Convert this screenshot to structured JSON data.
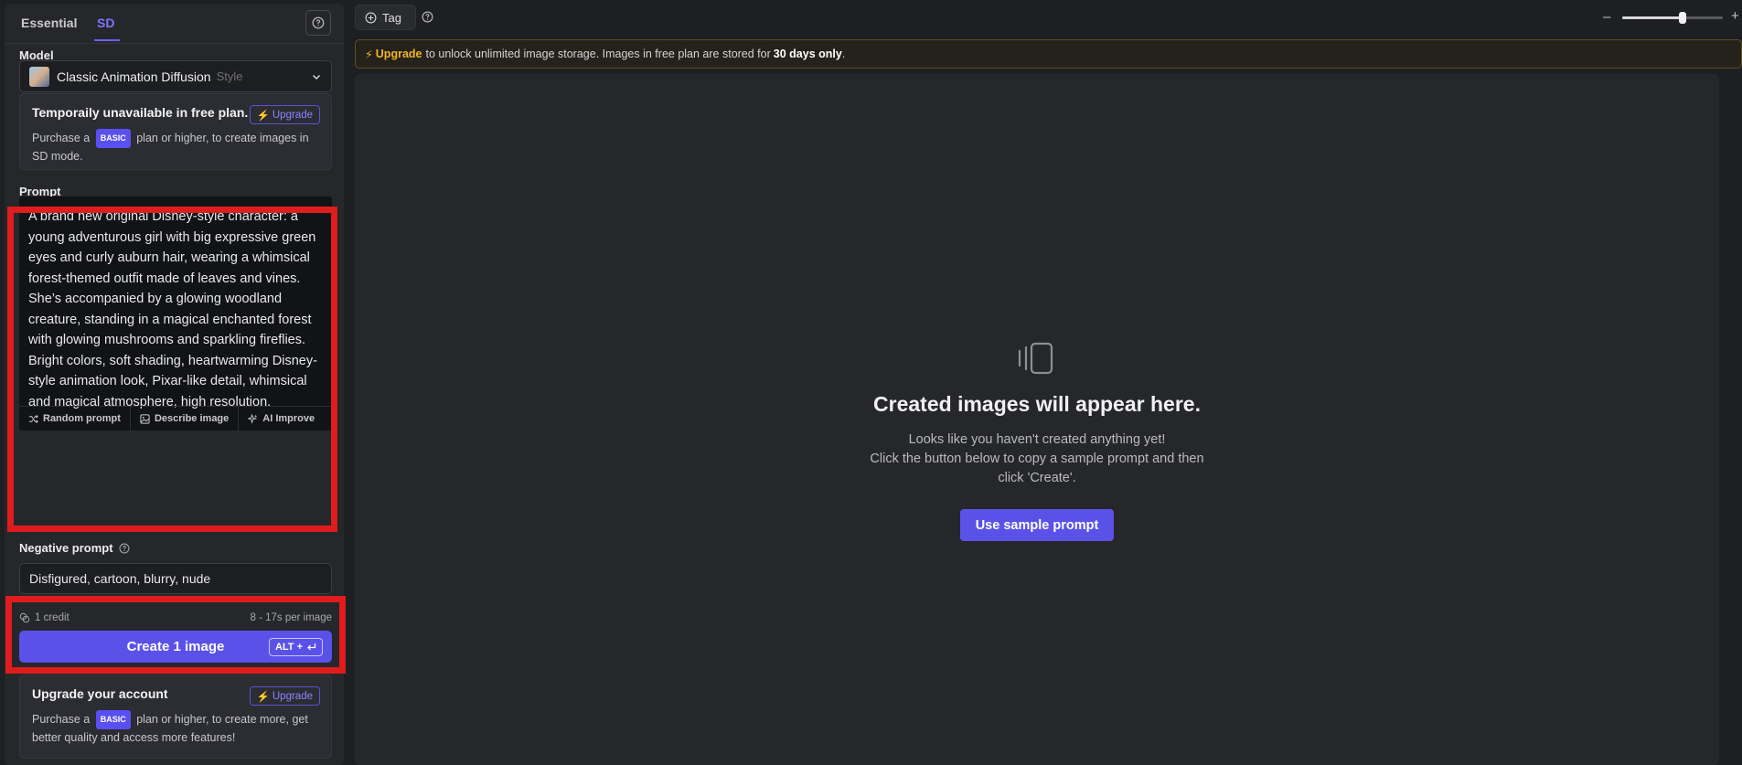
{
  "sidebar": {
    "tabs": [
      {
        "label": "Essential"
      },
      {
        "label": "SD"
      }
    ],
    "model": {
      "label": "Model",
      "name": "Classic Animation Diffusion",
      "style": "Style"
    },
    "unavailable": {
      "title": "Temporaily unavailable in free plan.",
      "upgrade_label": "Upgrade",
      "text_before": "Purchase a",
      "badge": "BASIC",
      "text_after": "plan or higher, to create images in SD mode."
    },
    "prompt": {
      "label": "Prompt",
      "value": "A brand new original Disney-style character: a young adventurous girl with big expressive green eyes and curly auburn hair, wearing a whimsical forest-themed outfit made of leaves and vines. She’s accompanied by a glowing woodland creature, standing in a magical enchanted forest with glowing mushrooms and sparkling fireflies. Bright colors, soft shading, heartwarming Disney-style animation look, Pixar-like detail, whimsical and magical atmosphere, high resolution.",
      "tools": [
        {
          "label": "Random prompt",
          "icon": "shuffle-icon"
        },
        {
          "label": "Describe image",
          "icon": "image-icon"
        },
        {
          "label": "AI Improve",
          "icon": "sparkle-icon"
        }
      ]
    },
    "negative": {
      "label": "Negative prompt",
      "value": "Disfigured, cartoon, blurry, nude"
    },
    "credit": {
      "label": "1 credit",
      "time": "8 - 17s per image"
    },
    "create": {
      "label": "Create 1 image",
      "shortcut": "ALT +"
    },
    "upgrade_account": {
      "title": "Upgrade your account",
      "upgrade_label": "Upgrade",
      "text_before": "Purchase a",
      "badge": "BASIC",
      "text_after": "plan or higher, to create more, get better quality and access more features!"
    }
  },
  "topbar": {
    "tag_label": "Tag",
    "zoom_level": 0.6
  },
  "banner": {
    "upgrade": "Upgrade",
    "text1": "to unlock unlimited image storage. Images in free plan are stored for",
    "bold": "30 days only",
    "text2": "."
  },
  "empty": {
    "title": "Created images will appear here.",
    "line1": "Looks like you haven't created anything yet!",
    "line2": "Click the button below to copy a sample prompt and then",
    "line3": "click 'Create'.",
    "button": "Use sample prompt"
  },
  "colors": {
    "accent": "#5a52e8",
    "highlight": "#e01c1c",
    "upgrade_yellow": "#f0b429"
  }
}
